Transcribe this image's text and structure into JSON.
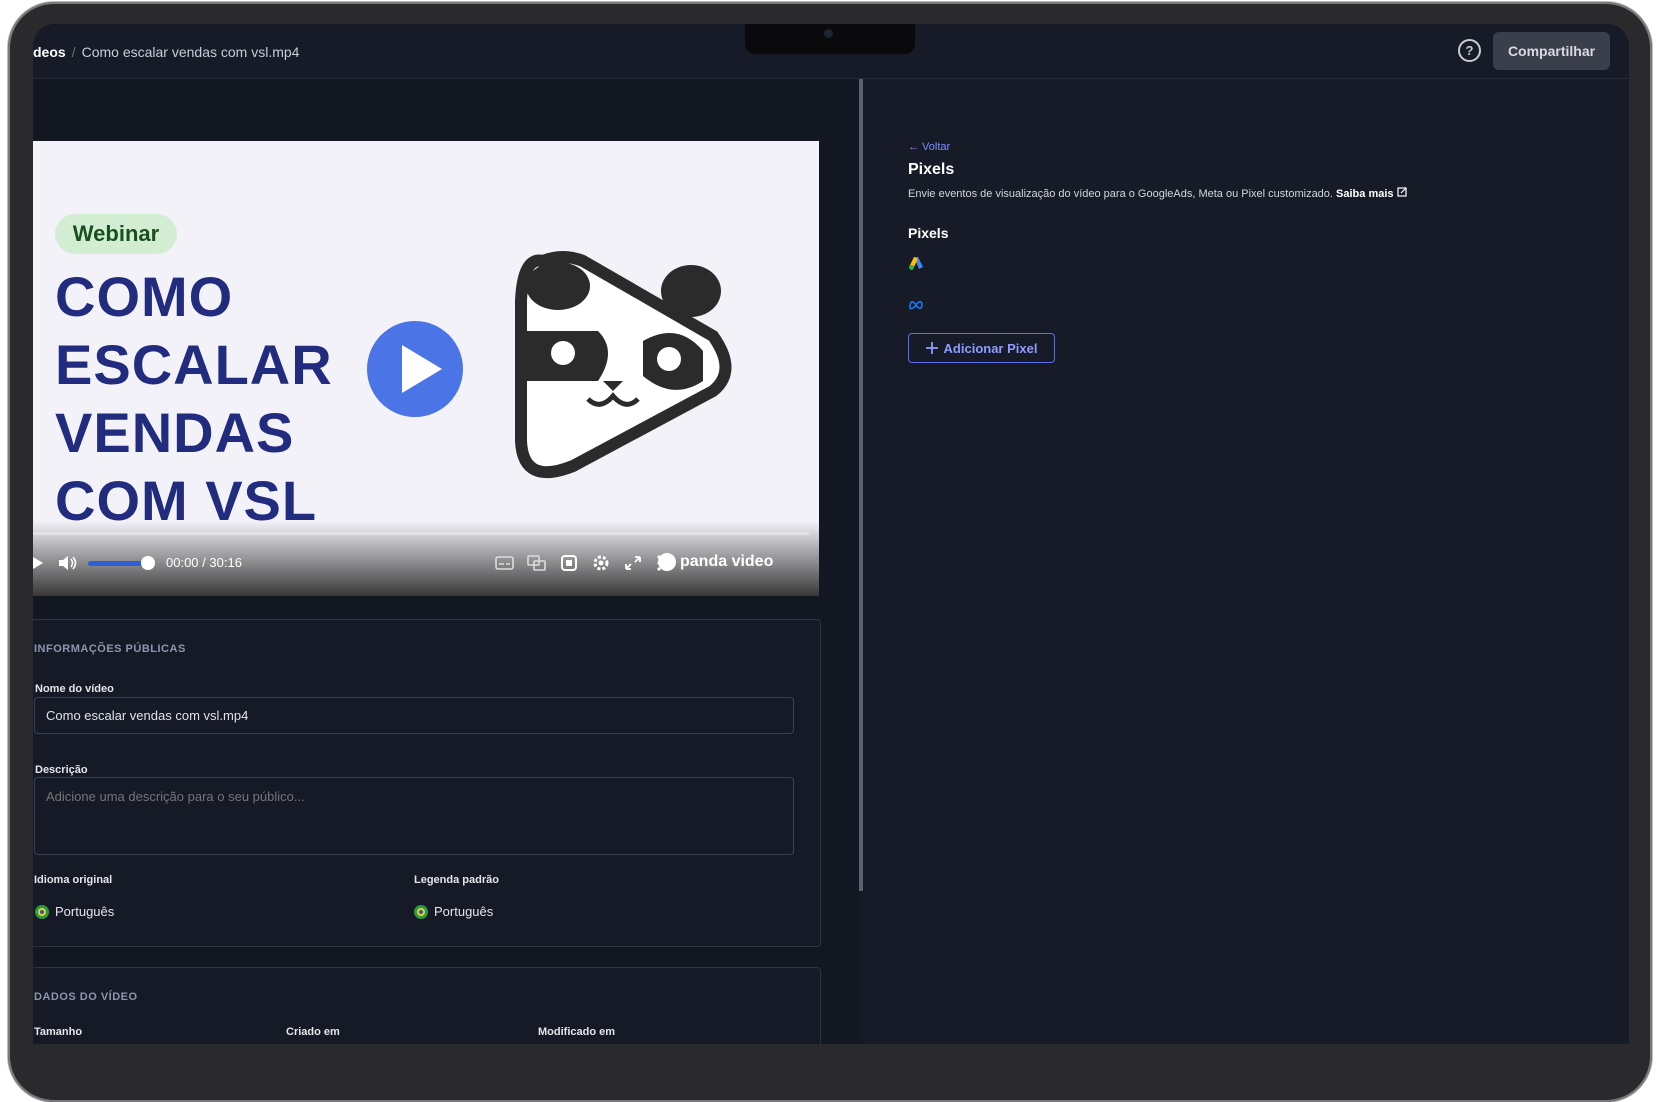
{
  "header": {
    "breadcrumb_root": "deos",
    "breadcrumb_sep": "/",
    "breadcrumb_current": "Como escalar vendas com vsl.mp4",
    "help_icon": "?",
    "share_label": "Compartilhar"
  },
  "video": {
    "badge": "Webinar",
    "title_lines": [
      "COMO",
      "ESCALAR",
      "VENDAS",
      "COM VSL"
    ],
    "current_time": "00:00",
    "time_sep": "/",
    "duration": "30:16",
    "volume_level": 0.85,
    "brand": "panda video",
    "icons": [
      "play-icon",
      "volume-icon",
      "subtitles-icon",
      "chat-icon",
      "quality-icon",
      "settings-icon",
      "fullscreen-icon",
      "more-icon"
    ]
  },
  "public_info": {
    "section_title": "INFORMAÇÕES PÚBLICAS",
    "name_label": "Nome do vídeo",
    "name_value": "Como escalar vendas com vsl.mp4",
    "description_label": "Descrição",
    "description_placeholder": "Adicione uma descrição para o seu público...",
    "original_language_label": "Idioma original",
    "original_language_value": "Português",
    "default_caption_label": "Legenda padrão",
    "default_caption_value": "Português"
  },
  "video_data": {
    "section_title": "DADOS DO VÍDEO",
    "size_label": "Tamanho",
    "created_label": "Criado em",
    "modified_label": "Modificado em"
  },
  "pixels_panel": {
    "back_label": "← Voltar",
    "title": "Pixels",
    "description": "Envie eventos de visualização do vídeo para o GoogleAds, Meta ou Pixel customizado.",
    "learn_more": "Saiba mais",
    "subtitle": "Pixels",
    "pixel_icons": [
      "google-ads-icon",
      "meta-icon"
    ],
    "add_label": "Adicionar Pixel"
  },
  "colors": {
    "accent": "#5b6cf0",
    "background": "#131722",
    "video_title": "#212c7e",
    "play_button": "#4b75e6"
  }
}
